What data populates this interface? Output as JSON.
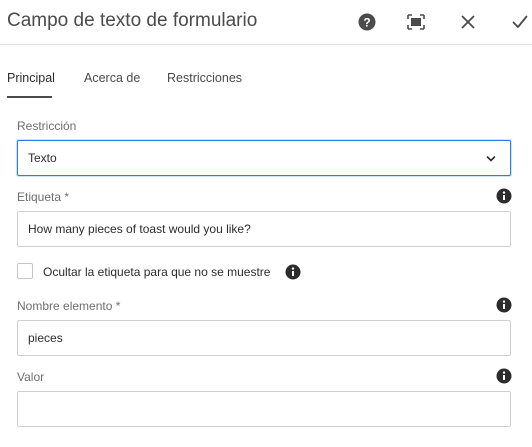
{
  "dialog": {
    "title": "Campo de texto de formulario"
  },
  "header_icons": [
    "help-icon",
    "fullscreen-icon",
    "close-icon",
    "checkmark-icon"
  ],
  "tabs": [
    {
      "label": "Principal",
      "active": true
    },
    {
      "label": "Acerca de",
      "active": false
    },
    {
      "label": "Restricciones",
      "active": false
    }
  ],
  "form": {
    "restriction": {
      "label": "Restricción",
      "value": "Texto"
    },
    "label_field": {
      "label": "Etiqueta *",
      "value": "How many pieces of toast would you like?"
    },
    "hide_label": {
      "label": "Ocultar la etiqueta para que no se muestre",
      "checked": false
    },
    "element_name": {
      "label": "Nombre elemento *",
      "value": "pieces"
    },
    "value_field": {
      "label": "Valor",
      "value": ""
    }
  },
  "colors": {
    "accent": "#2680eb",
    "icon": "#4b4b4b",
    "info": "#2c2c2c"
  }
}
